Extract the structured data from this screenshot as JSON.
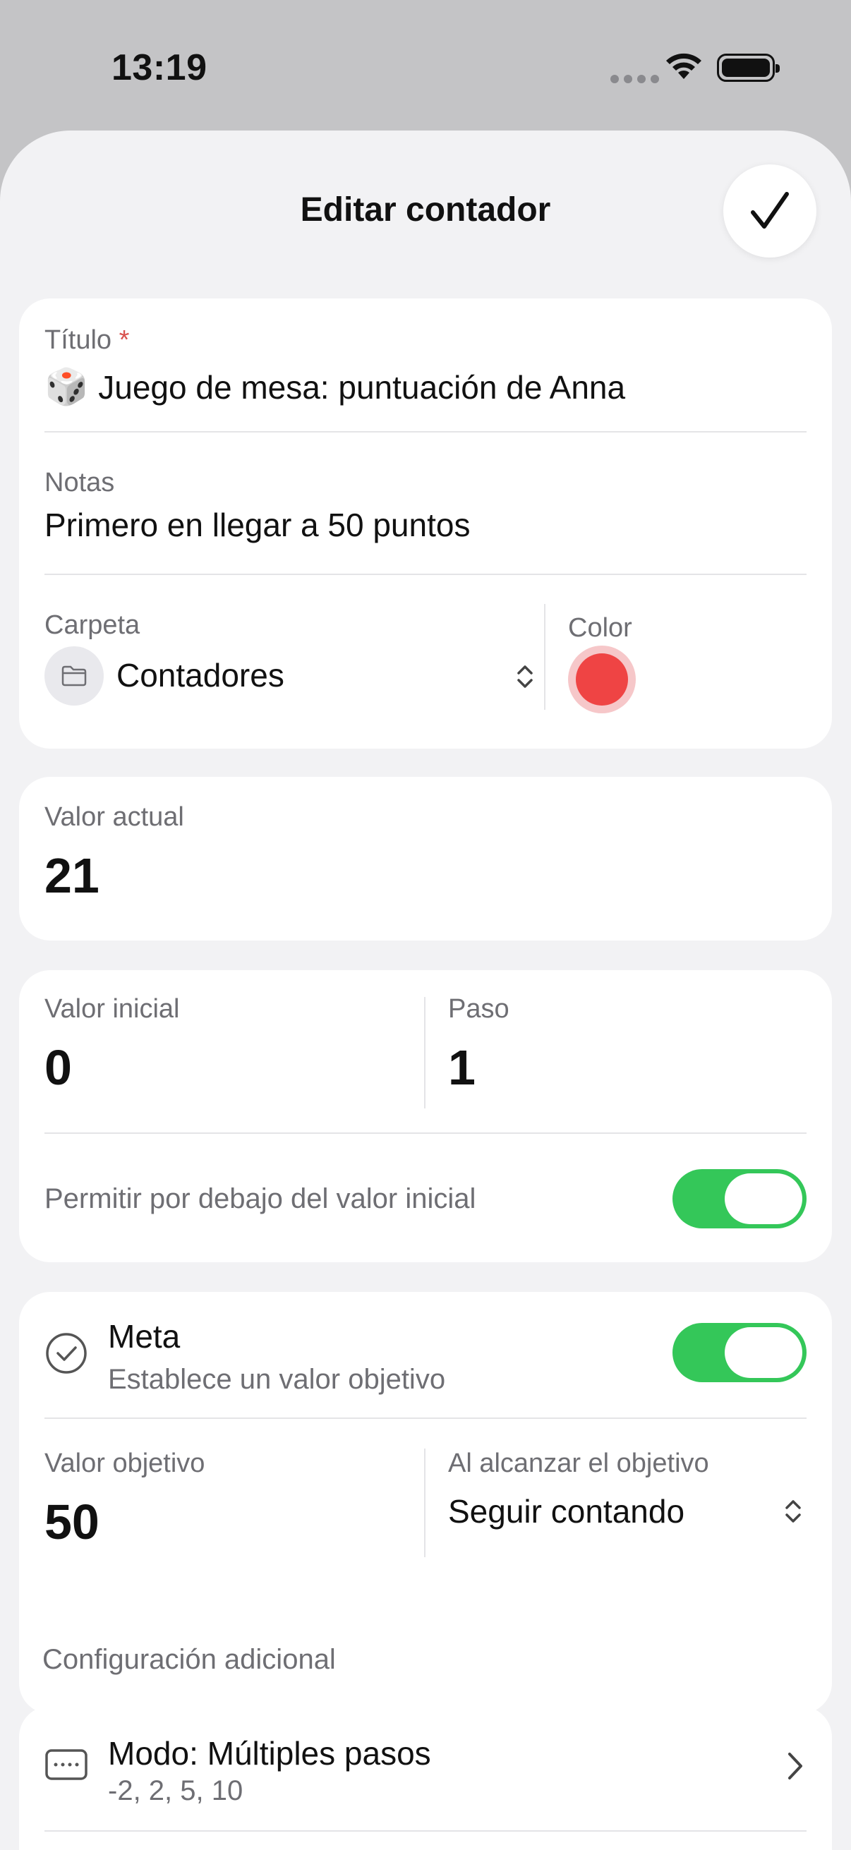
{
  "status_bar": {
    "time": "13:19"
  },
  "sheet": {
    "title": "Editar contador"
  },
  "details": {
    "title_label": "Título",
    "title_required_mark": "*",
    "title_emoji": "🎲",
    "title_value": "Juego de mesa: puntuación de Anna",
    "notes_label": "Notas",
    "notes_value": "Primero en llegar a 50 puntos",
    "folder_label": "Carpeta",
    "folder_value": "Contadores",
    "color_label": "Color",
    "color_value": "#ef4444"
  },
  "current": {
    "label": "Valor actual",
    "value": "21"
  },
  "params": {
    "initial_label": "Valor inicial",
    "initial_value": "0",
    "step_label": "Paso",
    "step_value": "1",
    "allow_below_label": "Permitir por debajo del valor inicial",
    "allow_below_enabled": true
  },
  "goal": {
    "title": "Meta",
    "subtitle": "Establece un valor objetivo",
    "enabled": true,
    "target_label": "Valor objetivo",
    "target_value": "50",
    "on_reach_label": "Al alcanzar el objetivo",
    "on_reach_value": "Seguir contando"
  },
  "extra": {
    "header": "Configuración adicional",
    "mode_title": "Modo: Múltiples pasos",
    "mode_subtitle": "-2, 2, 5, 10"
  },
  "colors": {
    "accent_toggle": "#34c759",
    "required": "#d9534f"
  }
}
